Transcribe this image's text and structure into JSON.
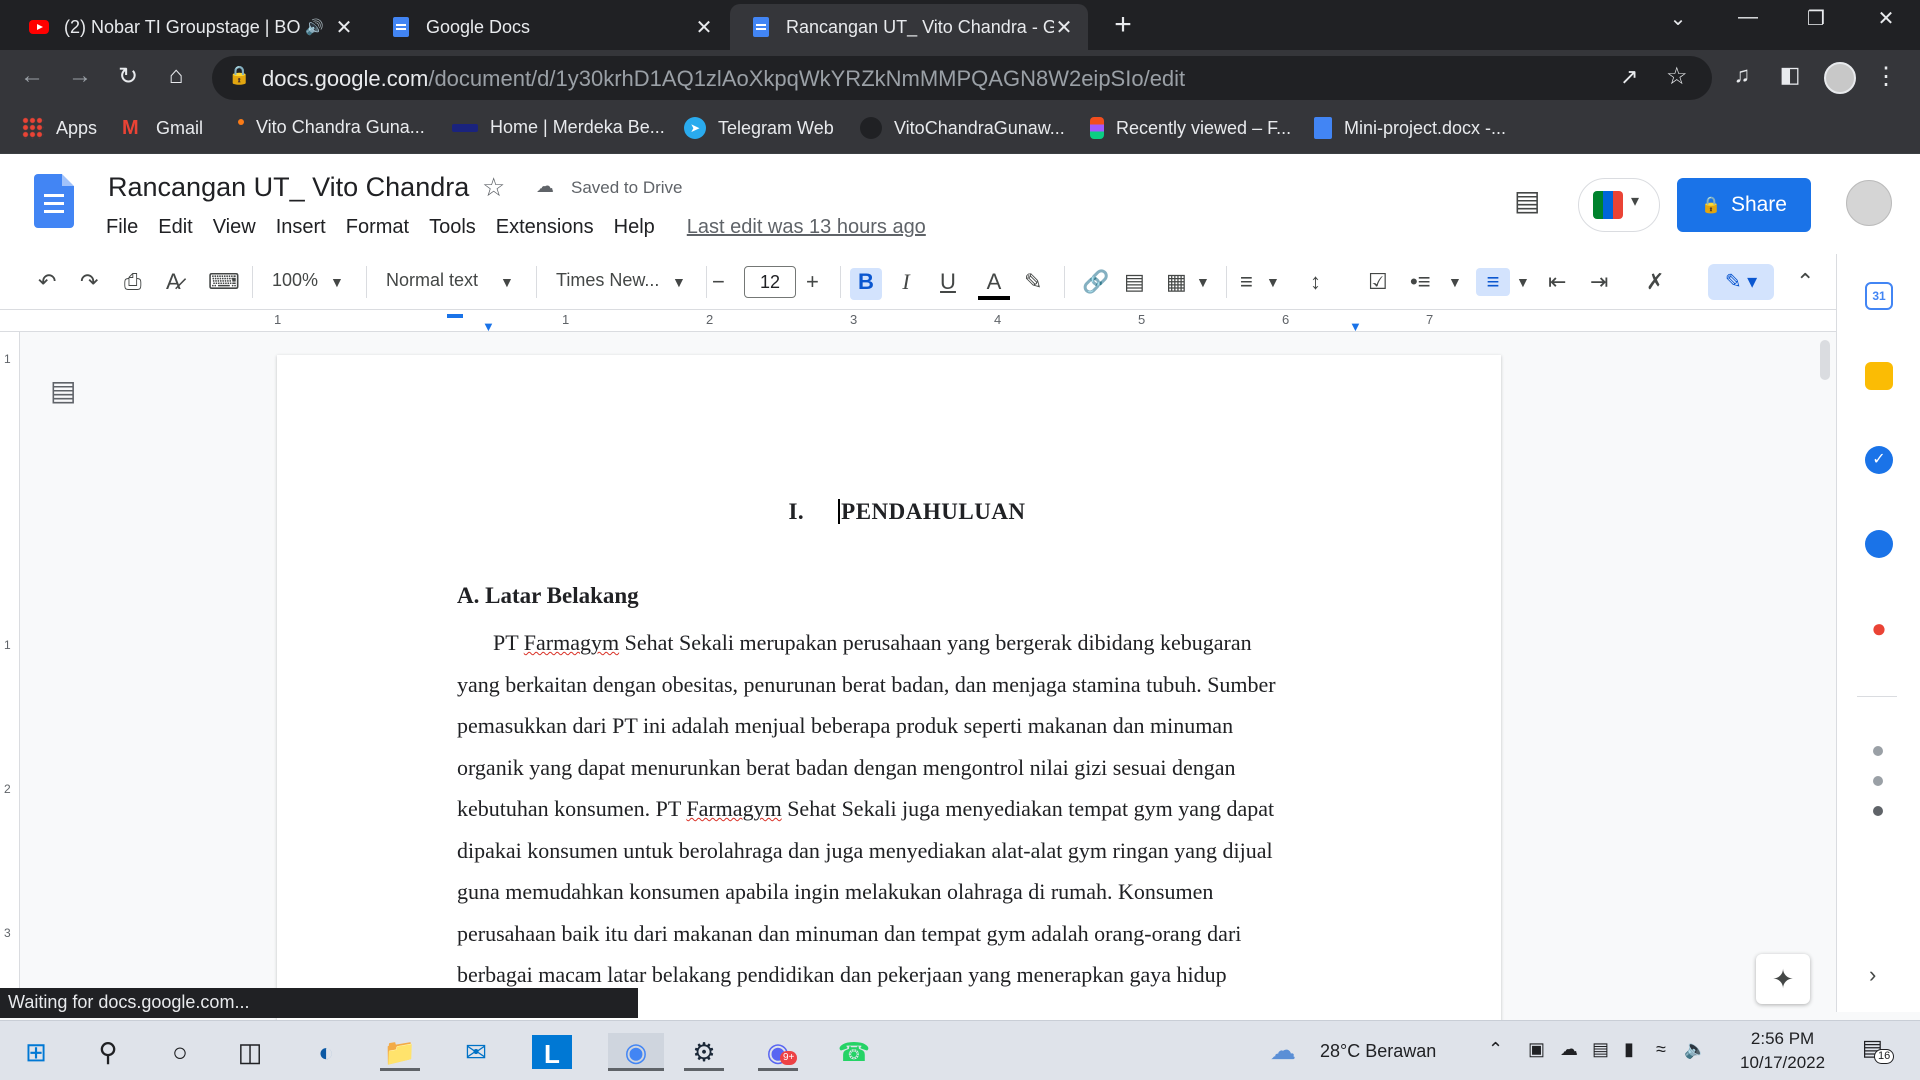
{
  "browser": {
    "tabs": [
      {
        "title": "(2) Nobar TI Groupstage | BO",
        "active": false,
        "audio": true
      },
      {
        "title": "Google Docs",
        "active": false
      },
      {
        "title": "Rancangan UT_ Vito Chandra - G",
        "active": true
      }
    ],
    "url_domain": "docs.google.com",
    "url_path": "/document/d/1y30krhD1AQ1zlAoXkpqWkYRZkNmMMPQAGN8W2eipSIo/edit",
    "bookmarks": [
      "Apps",
      "Gmail",
      "Vito Chandra Guna...",
      "Home | Merdeka Be...",
      "Telegram Web",
      "VitoChandraGunaw...",
      "Recently viewed – F...",
      "Mini-project.docx -..."
    ]
  },
  "docs": {
    "title": "Rancangan UT_ Vito Chandra",
    "saved_status": "Saved to Drive",
    "menus": [
      "File",
      "Edit",
      "View",
      "Insert",
      "Format",
      "Tools",
      "Extensions",
      "Help"
    ],
    "last_edit": "Last edit was 13 hours ago",
    "share_label": "Share"
  },
  "toolbar": {
    "zoom": "100%",
    "style": "Normal text",
    "font": "Times New...",
    "font_size": "12"
  },
  "ruler": {
    "marks": [
      "1",
      "1",
      "2",
      "3",
      "4",
      "5",
      "6",
      "7"
    ],
    "vertical_marks": [
      "1",
      "1",
      "2",
      "3"
    ]
  },
  "document": {
    "heading_num": "I.",
    "heading_text": "PENDAHULUAN",
    "subheading": "A.  Latar Belakang",
    "para": {
      "l1a": "PT ",
      "l1b": "Farmagym",
      "l1c": " Sehat Sekali merupakan perusahaan yang bergerak dibidang kebugaran",
      "l2": "yang berkaitan dengan obesitas, penurunan berat badan, dan menjaga stamina tubuh. Sumber",
      "l3": "pemasukkan dari PT ini adalah menjual beberapa produk seperti makanan dan minuman",
      "l4": "organik yang dapat menurunkan berat badan dengan mengontrol nilai gizi sesuai dengan",
      "l5a": "kebutuhan konsumen. PT ",
      "l5b": "Farmagym",
      "l5c": " Sehat Sekali juga menyediakan tempat gym yang dapat",
      "l6": "dipakai konsumen untuk berolahraga dan juga menyediakan alat-alat gym ringan yang dijual",
      "l7": "guna memudahkan konsumen apabila ingin melakukan olahraga di rumah. Konsumen",
      "l8": "perusahaan baik itu dari makanan dan minuman dan tempat gym adalah orang-orang dari",
      "l9": "berbagai macam latar belakang pendidikan dan pekerjaan yang menerapkan gaya hidup"
    }
  },
  "status_text": "Waiting for docs.google.com...",
  "taskbar": {
    "weather": "28°C  Berawan",
    "time": "2:56 PM",
    "date": "10/17/2022",
    "notifications": "16",
    "discord_badge": "9+"
  },
  "colors": {
    "accent": "#1a73e8",
    "chrome_dark": "#202124",
    "chrome_tab": "#35363a"
  }
}
